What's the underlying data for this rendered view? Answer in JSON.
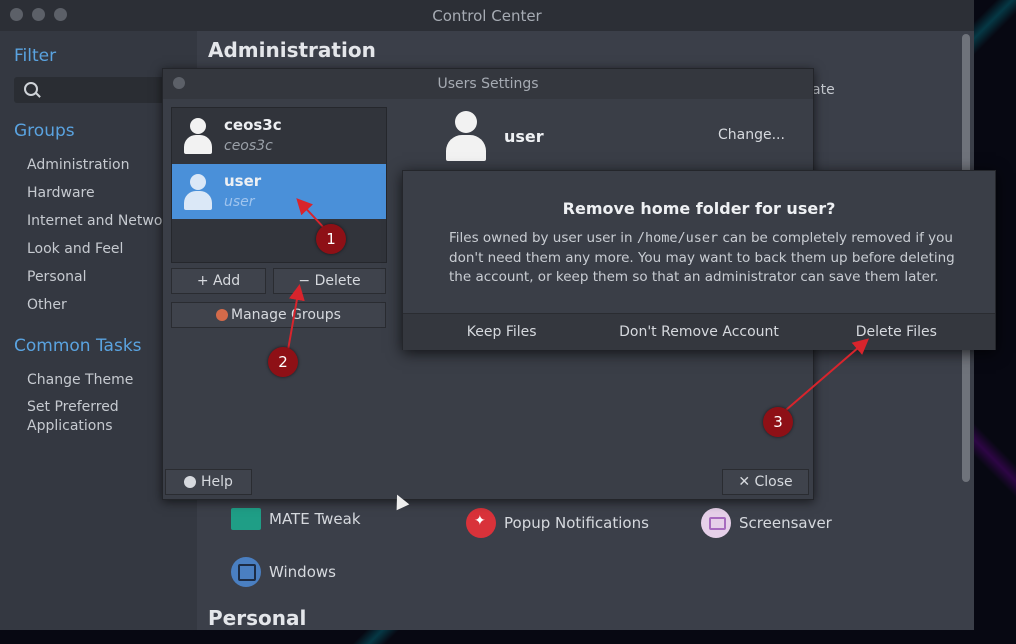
{
  "window": {
    "title": "Control Center"
  },
  "sidebar": {
    "filter_heading": "Filter",
    "groups_heading": "Groups",
    "groups": [
      "Administration",
      "Hardware",
      "Internet and Network",
      "Look and Feel",
      "Personal",
      "Other"
    ],
    "common_tasks_heading": "Common Tasks",
    "tasks": [
      "Change Theme",
      "Set Preferred",
      "Applications"
    ]
  },
  "main": {
    "section_administration": "Administration",
    "hidden_text": "ate",
    "launchers": [
      {
        "label": "MATE Tweak",
        "icon": "mate-tweak-icon"
      },
      {
        "label": "Popup Notifications",
        "icon": "popup-notifications-icon"
      },
      {
        "label": "Screensaver",
        "icon": "screensaver-icon"
      },
      {
        "label": "Windows",
        "icon": "windows-icon"
      }
    ],
    "section_personal": "Personal"
  },
  "users_settings": {
    "title": "Users Settings",
    "users": [
      {
        "name": "ceos3c",
        "fullname": "ceos3c"
      },
      {
        "name": "user",
        "fullname": "user"
      }
    ],
    "add_label": "+ Add",
    "delete_label": "− Delete",
    "manage_groups_label": "Manage Groups",
    "selected_user": "user",
    "change_label": "Change...",
    "help_label": "Help",
    "close_label": "✕ Close"
  },
  "dialog": {
    "title": "Remove home folder for user?",
    "body_pre": "Files owned by user user in ",
    "body_path": "/home/user",
    "body_post": " can be completely removed if you don't need them any more. You may want to back them up before deleting the account, or keep them so that an administrator can save them later.",
    "keep_label": "Keep Files",
    "dont_remove_label": "Don't Remove Account",
    "delete_label": "Delete Files"
  },
  "annotations": [
    "1",
    "2",
    "3"
  ],
  "colors": {
    "accent_blue": "#4a90d9",
    "heading_blue": "#5aa3e0",
    "marker_red": "#8e1016"
  }
}
